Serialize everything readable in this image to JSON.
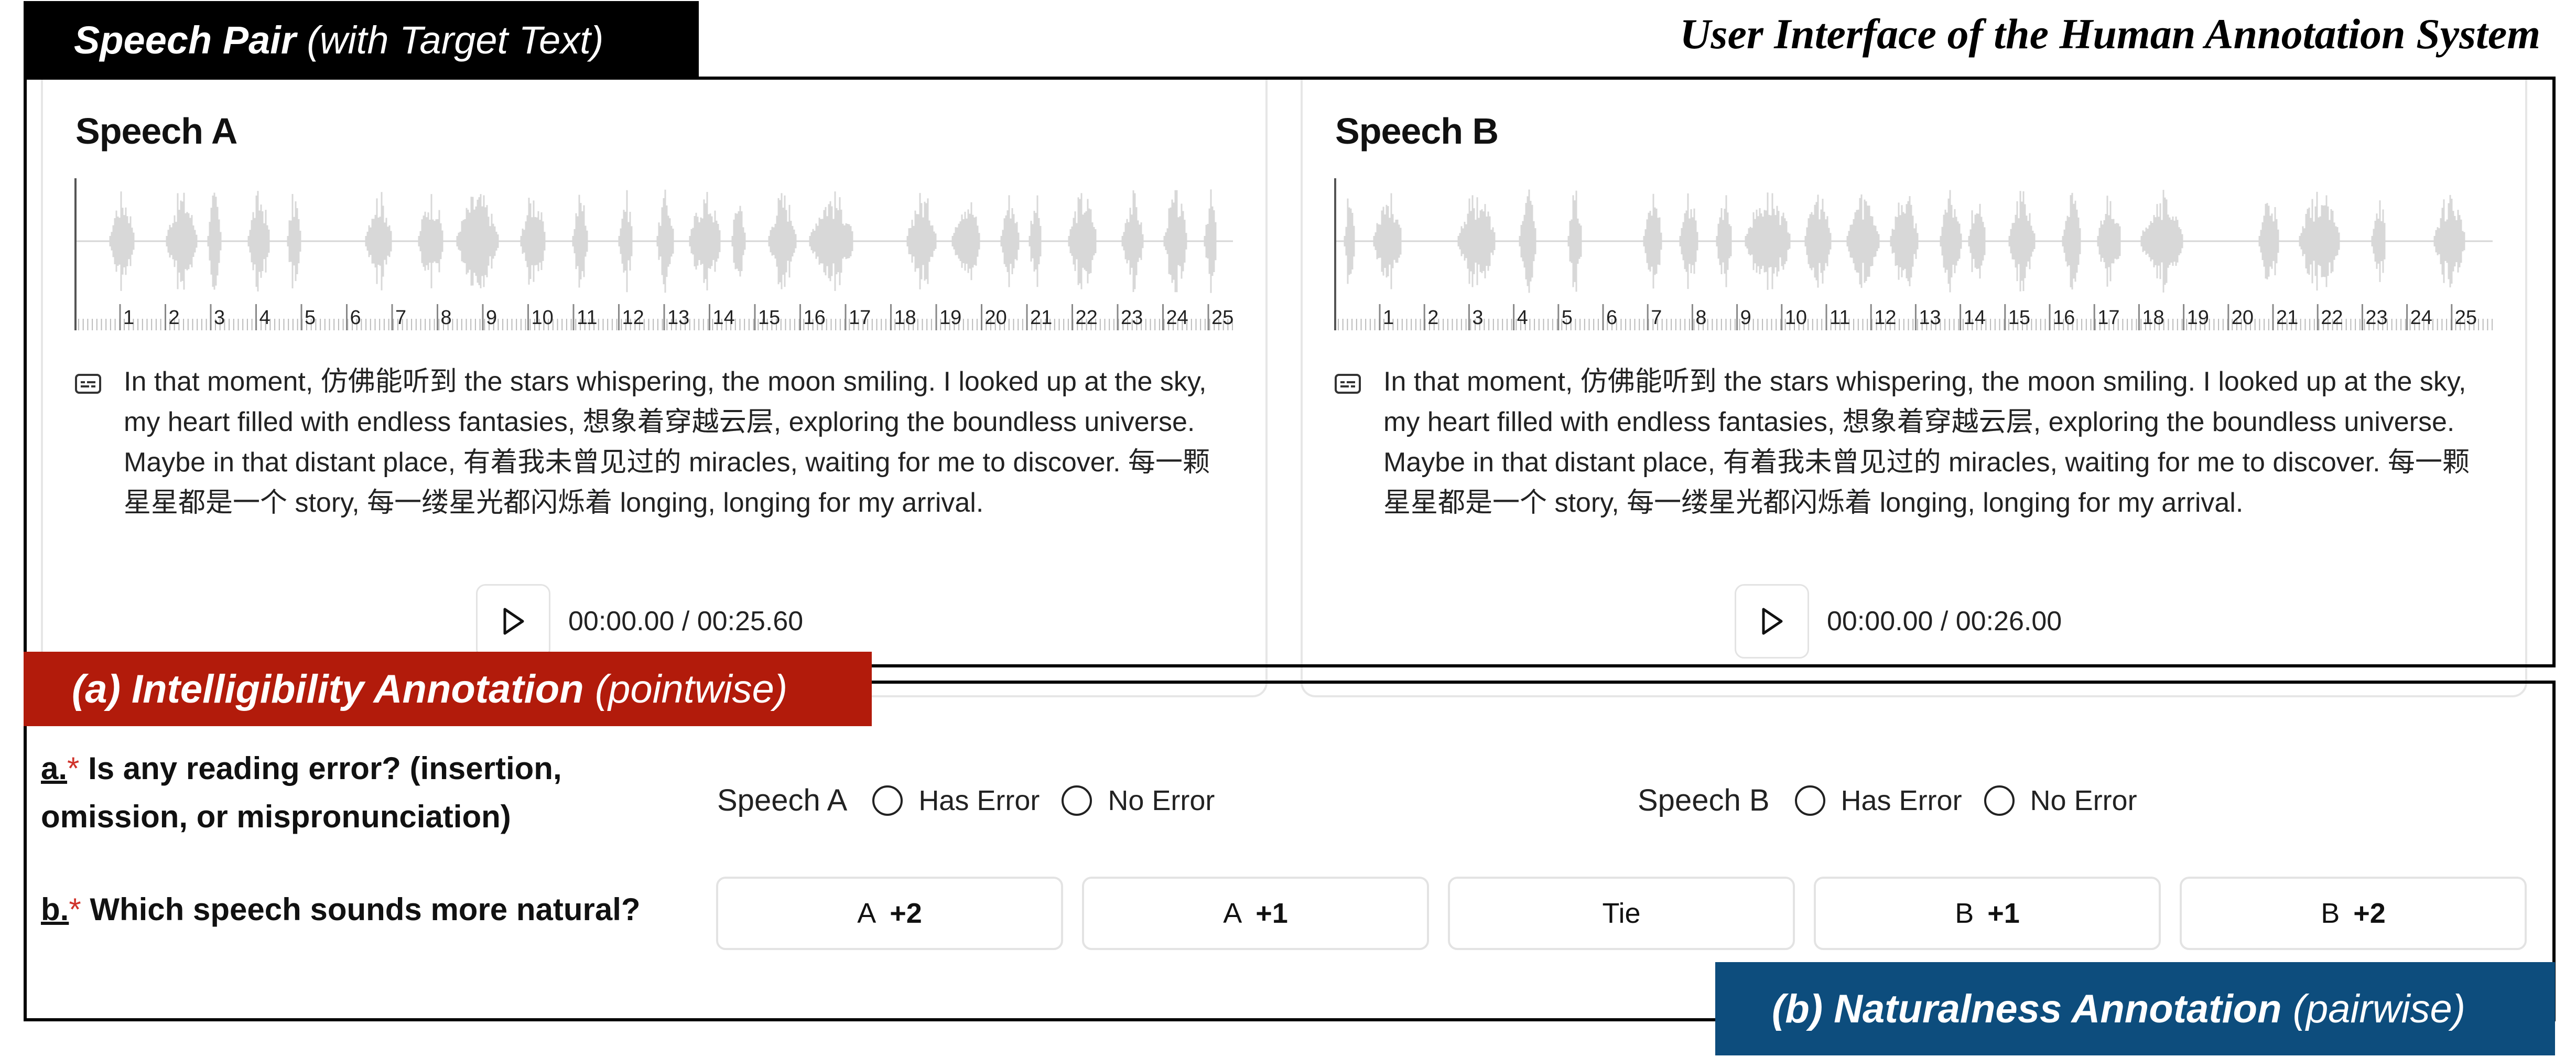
{
  "page_title": "User Interface of the Human Annotation System",
  "banners": {
    "speech_pair_bold": "Speech Pair",
    "speech_pair_light": "(with Target Text)",
    "intelligibility_bold": "(a) Intelligibility Annotation",
    "intelligibility_light": "(pointwise)",
    "naturalness_bold": "(b) Naturalness Annotation",
    "naturalness_light": "(pairwise)"
  },
  "speech_a": {
    "title": "Speech A",
    "ticks": [
      "1",
      "2",
      "3",
      "4",
      "5",
      "6",
      "7",
      "8",
      "9",
      "10",
      "11",
      "12",
      "13",
      "14",
      "15",
      "16",
      "17",
      "18",
      "19",
      "20",
      "21",
      "22",
      "23",
      "24",
      "25"
    ],
    "transcript": "In that moment, 仿佛能听到 the stars whispering, the moon smiling. I looked up at the sky, my heart filled with endless fantasies, 想象着穿越云层, exploring the boundless universe. Maybe in that distant place, 有着我未曾见过的 miracles, waiting for me to discover. 每一颗星星都是一个 story, 每一缕星光都闪烁着 longing, longing for my arrival.",
    "time": "00:00.00 / 00:25.60"
  },
  "speech_b": {
    "title": "Speech B",
    "ticks": [
      "1",
      "2",
      "3",
      "4",
      "5",
      "6",
      "7",
      "8",
      "9",
      "10",
      "11",
      "12",
      "13",
      "14",
      "15",
      "16",
      "17",
      "18",
      "19",
      "20",
      "21",
      "22",
      "23",
      "24",
      "25"
    ],
    "transcript": "In that moment, 仿佛能听到 the stars whispering, the moon smiling. I looked up at the sky, my heart filled with endless fantasies, 想象着穿越云层, exploring the boundless universe. Maybe in that distant place, 有着我未曾见过的 miracles, waiting for me to discover. 每一颗星星都是一个 story, 每一缕星光都闪烁着 longing, longing for my arrival.",
    "time": "00:00.00 / 00:26.00"
  },
  "question_a": {
    "mark": "a.",
    "star": "*",
    "line1": "Is any reading error? (insertion,",
    "line2": "omission, or mispronunciation)",
    "speech_a_label": "Speech A",
    "speech_b_label": "Speech B",
    "has_error": "Has Error",
    "no_error": "No Error"
  },
  "question_b": {
    "mark": "b.",
    "star": "*",
    "text": "Which speech sounds more natural?",
    "choices": [
      {
        "side": "A",
        "score": "+2"
      },
      {
        "side": "A",
        "score": "+1"
      },
      {
        "side": "Tie",
        "score": ""
      },
      {
        "side": "B",
        "score": "+1"
      },
      {
        "side": "B",
        "score": "+2"
      }
    ]
  }
}
